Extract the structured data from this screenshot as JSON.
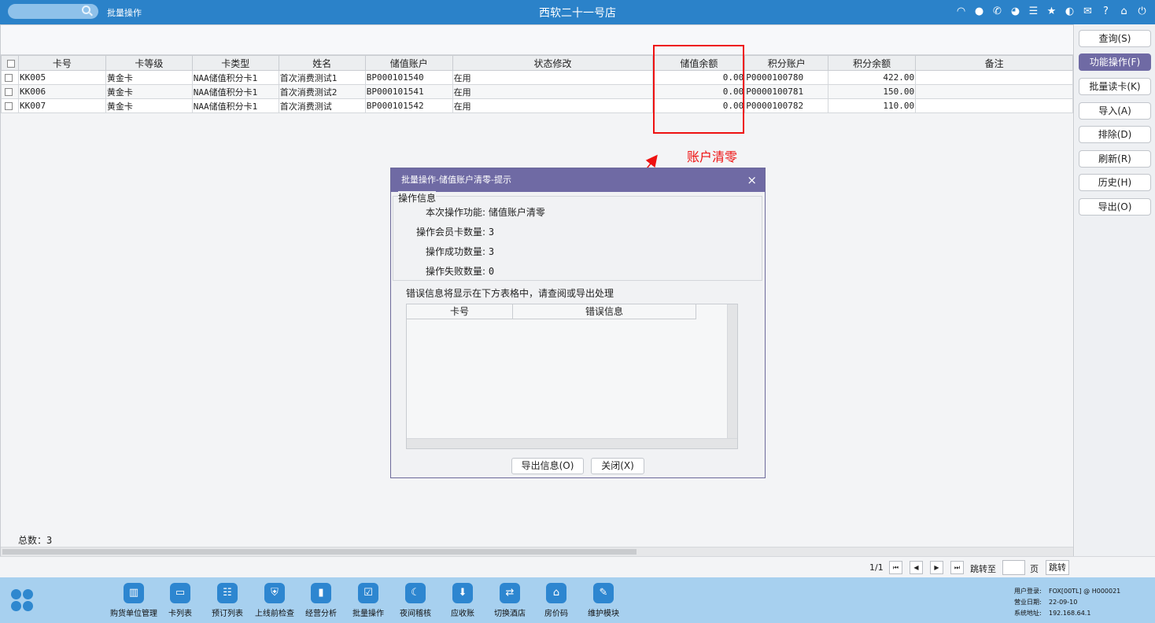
{
  "topbar": {
    "module_title": "批量操作",
    "store_title": "西软二十一号店",
    "icons": [
      "wifi-icon",
      "chat-icon",
      "phone-icon",
      "palette-icon",
      "menu-icon",
      "star-icon",
      "moon-icon",
      "mail-icon",
      "help-icon",
      "home-icon",
      "power-icon"
    ]
  },
  "grid": {
    "columns": [
      "卡号",
      "卡等级",
      "卡类型",
      "姓名",
      "储值账户",
      "状态修改",
      "储值余额",
      "积分账户",
      "积分余额",
      "备注"
    ],
    "rows": [
      {
        "card_no": "KK005",
        "level": "黄金卡",
        "type": "NAA储值积分卡1",
        "name": "首次消费测试1",
        "account": "BP000101540",
        "status": "在用",
        "balance": "0.00",
        "points_account": "P0000100780",
        "points": "422.00",
        "note": ""
      },
      {
        "card_no": "KK006",
        "level": "黄金卡",
        "type": "NAA储值积分卡1",
        "name": "首次消费测试2",
        "account": "BP000101541",
        "status": "在用",
        "balance": "0.00",
        "points_account": "P0000100781",
        "points": "150.00",
        "note": ""
      },
      {
        "card_no": "KK007",
        "level": "黄金卡",
        "type": "NAA储值积分卡1",
        "name": "首次消费测试",
        "account": "BP000101542",
        "status": "在用",
        "balance": "0.00",
        "points_account": "P0000100782",
        "points": "110.00",
        "note": ""
      }
    ],
    "total": "总数：3"
  },
  "right_panel": {
    "buttons": [
      "查询(S)",
      "功能操作(F)",
      "批量读卡(K)",
      "导入(A)",
      "排除(D)",
      "刷新(R)",
      "历史(H)",
      "导出(O)"
    ]
  },
  "annotation": {
    "text": "账户清零",
    "color": "#ee1111"
  },
  "dialog": {
    "title": "批量操作-储值账户清零-提示",
    "group_label": "操作信息",
    "info": [
      {
        "label": "本次操作功能:",
        "value": "储值账户清零"
      },
      {
        "label": "操作会员卡数量:",
        "value": "3"
      },
      {
        "label": "操作成功数量:",
        "value": "3"
      },
      {
        "label": "操作失败数量:",
        "value": "0"
      }
    ],
    "error_note": "错误信息将显示在下方表格中，请查阅或导出处理",
    "error_columns": [
      "卡号",
      "错误信息"
    ],
    "export_button": "导出信息(O)",
    "close_button": "关闭(X)"
  },
  "pager": {
    "page": "1/1",
    "jump_label": "跳转至",
    "page_unit": "页",
    "go_button": "跳转"
  },
  "dock": {
    "items": [
      "购货单位管理",
      "卡列表",
      "预订列表",
      "上线前检查",
      "经营分析",
      "批量操作",
      "夜间稽核",
      "应收账",
      "切换酒店",
      "房价码",
      "维护模块"
    ],
    "info": [
      {
        "label": "用户登录:",
        "value": "FOX[00TL] @ H000021"
      },
      {
        "label": "营业日期:",
        "value": "22-09-10"
      },
      {
        "label": "系统地址:",
        "value": "192.168.64.1"
      }
    ]
  }
}
